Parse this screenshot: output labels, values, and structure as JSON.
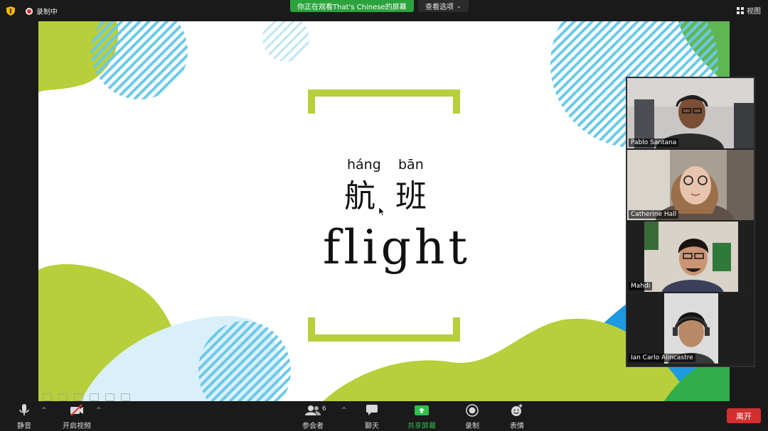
{
  "topbar": {
    "recording_label": "录制中",
    "banner_text": "你正在观看That's Chinese的屏幕",
    "view_options_label": "查看选项",
    "view_label": "视图"
  },
  "slide": {
    "pinyin_1": "háng",
    "pinyin_2": "bān",
    "hanzi_1": "航",
    "hanzi_2": "班",
    "english_word": "flight"
  },
  "participants": [
    {
      "name": "Pablo Santana"
    },
    {
      "name": "Catherine Hall"
    },
    {
      "name": "Mahdi"
    },
    {
      "name": "Ian Carlo Alincastre"
    }
  ],
  "toolbar": {
    "mute_label": "静音",
    "video_label": "开启视频",
    "participants_label": "参会者",
    "participant_count": "6",
    "chat_label": "聊天",
    "share_label": "共享屏幕",
    "record_label": "录制",
    "reactions_label": "表情",
    "leave_label": "离开"
  },
  "colors": {
    "accent_green": "#b7cf3a",
    "share_green": "#2fbd4c",
    "banner_green": "#2aa33c",
    "leave_red": "#d32f2f",
    "stripe_blue": "#6cc9e8",
    "deep_blue": "#1e9be0"
  }
}
